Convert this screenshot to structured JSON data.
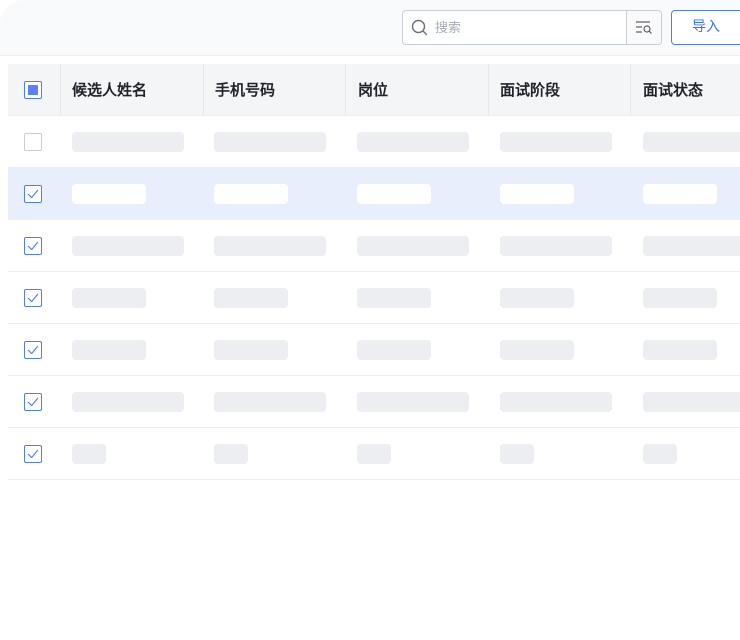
{
  "toolbar": {
    "search_placeholder": "搜索",
    "search_value": "",
    "import_label": "导入"
  },
  "table": {
    "columns": [
      "候选人姓名",
      "手机号码",
      "岗位",
      "面试阶段",
      "面试状态"
    ],
    "rows": [
      {
        "checked": false,
        "selected": false,
        "loading": true
      },
      {
        "checked": true,
        "selected": true,
        "loading": true
      },
      {
        "checked": true,
        "selected": false,
        "loading": true
      },
      {
        "checked": true,
        "selected": false,
        "loading": true
      },
      {
        "checked": true,
        "selected": false,
        "loading": true
      },
      {
        "checked": true,
        "selected": false,
        "loading": true
      },
      {
        "checked": true,
        "selected": false,
        "loading": true
      }
    ]
  },
  "colors": {
    "accent": "#4d7cf5",
    "selected_row": "#e8eefc",
    "skeleton": "#edeef1"
  },
  "icons": [
    "search-icon",
    "filter-icon",
    "checkbox-icon"
  ]
}
